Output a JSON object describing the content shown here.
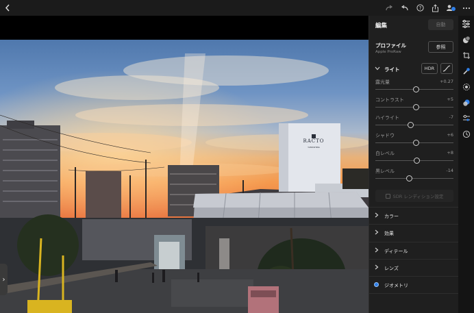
{
  "topbar": {
    "back_icon": "chevron-left-icon",
    "redo_icon": "redo-icon",
    "undo_icon": "undo-icon",
    "help_icon": "help-icon",
    "share_icon": "share-icon",
    "people_icon": "people-icon",
    "more_icon": "more-icon"
  },
  "panel": {
    "title": "編集",
    "auto_label": "自動",
    "profile_label": "プロファイル",
    "profile_value": "Apple ProRaw",
    "browse_label": "参照",
    "light_title": "ライト",
    "hdr_label": "HDR",
    "sliders": [
      {
        "label": "露光量",
        "value": "+0.27",
        "level": 0.52
      },
      {
        "label": "コントラスト",
        "value": "+5",
        "level": 0.52
      },
      {
        "label": "ハイライト",
        "value": "-7",
        "level": 0.45
      },
      {
        "label": "シャドウ",
        "value": "+6",
        "level": 0.52
      },
      {
        "label": "白レベル",
        "value": "+8",
        "level": 0.53
      },
      {
        "label": "黒レベル",
        "value": "-14",
        "level": 0.43
      }
    ],
    "sdr_label": "SDR レンディション設定",
    "sections": [
      {
        "label": "カラー"
      },
      {
        "label": "効果"
      },
      {
        "label": "ディテール"
      },
      {
        "label": "レンズ"
      },
      {
        "label": "ジオメトリ"
      }
    ]
  },
  "photo": {
    "sign_text": "RACTO",
    "sign_subtext": "YAMASHINA"
  },
  "accent_color": "#2f7fe8"
}
